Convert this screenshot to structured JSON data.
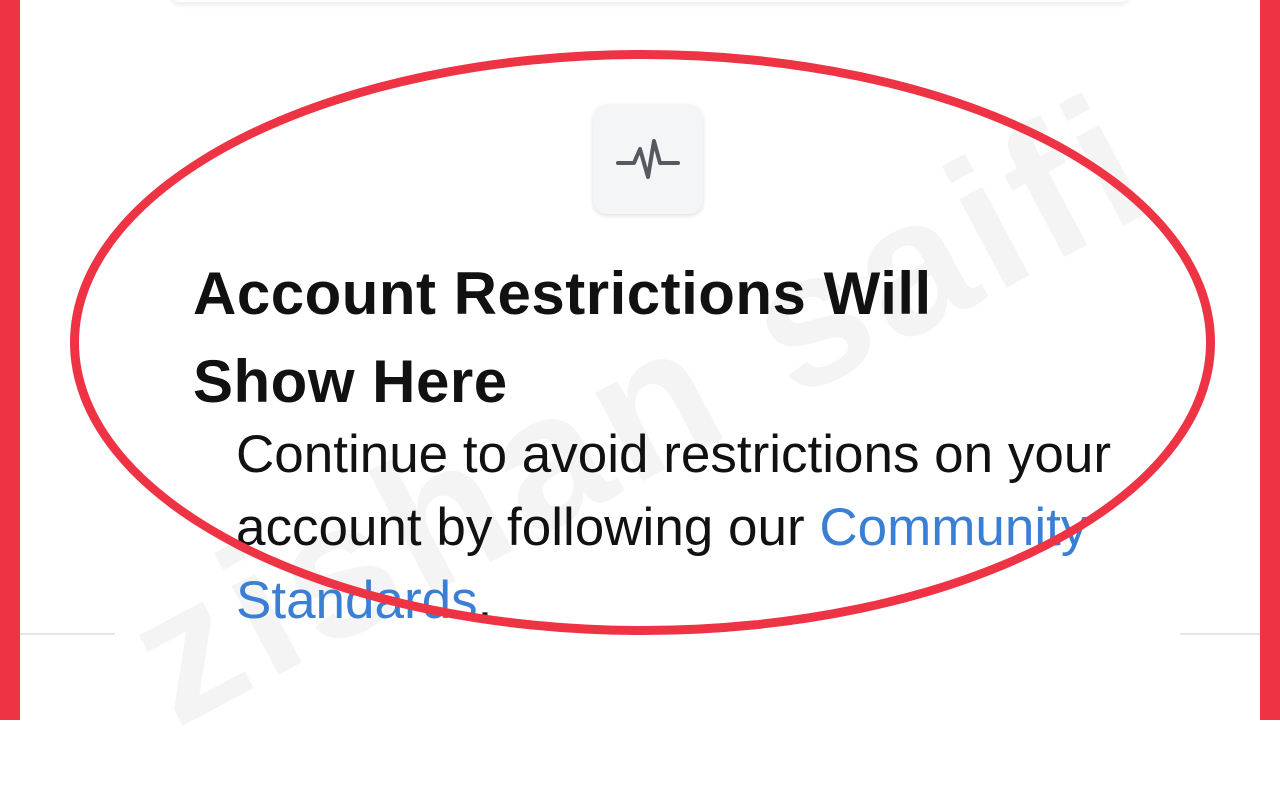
{
  "status": {
    "icon": "activity-pulse-icon",
    "heading": "Account Restrictions Will Show Here",
    "body_text": "Continue to avoid restrictions on your account by following our",
    "link_text": "Community Standards",
    "trailing_punct": "."
  },
  "watermark": {
    "text": "zishan saifi"
  },
  "colors": {
    "highlight": "#ee3344",
    "link": "#3b7fd4",
    "text": "#111111"
  }
}
